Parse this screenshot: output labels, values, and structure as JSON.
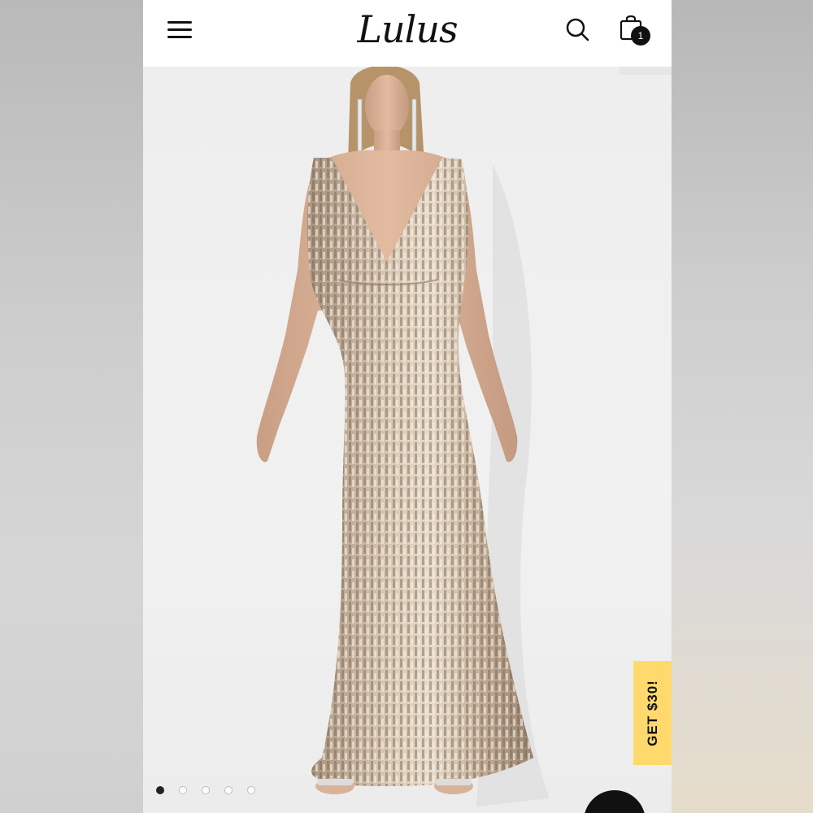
{
  "header": {
    "logo_text": "Lulus",
    "cart_count": "1"
  },
  "icons": {
    "menu": "hamburger-menu-icon",
    "search": "search-icon",
    "cart": "shopping-bag-icon"
  },
  "product_image": {
    "alt": "Model wearing a sleeveless V-neck champagne sequin mermaid maxi dress"
  },
  "promo": {
    "label": "GET $30!",
    "color": "#ffd96b"
  },
  "carousel": {
    "total": 5,
    "active_index": 0
  },
  "colors": {
    "accent": "#111111",
    "dress": "#c7b199"
  }
}
